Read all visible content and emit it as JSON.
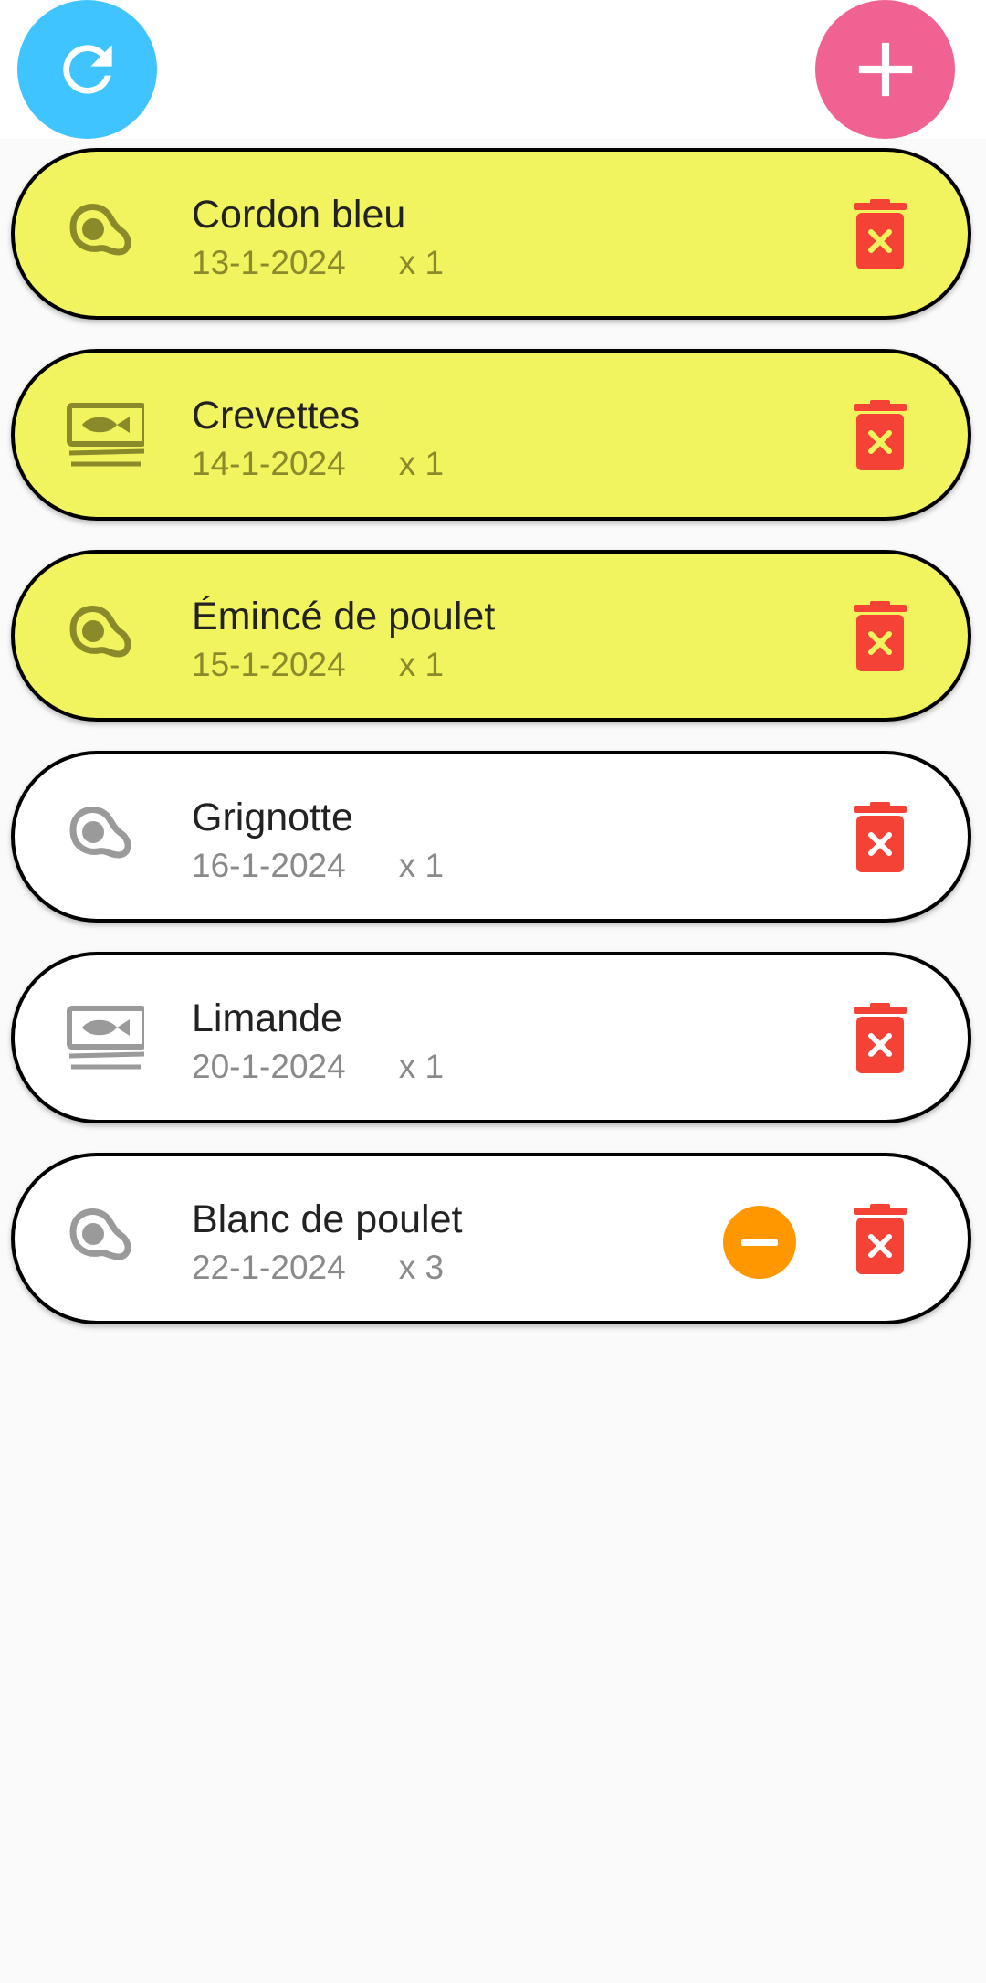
{
  "toolbar": {
    "refresh_icon": "refresh-icon",
    "add_icon": "plus-icon",
    "refresh_color": "#40c4ff",
    "add_color": "#f06292"
  },
  "colors": {
    "highlight_background": "#f1f45f",
    "plain_background": "#ffffff",
    "delete_color": "#f44336",
    "minus_color": "#ff9800"
  },
  "items": [
    {
      "name": "Cordon bleu",
      "date": "13-1-2024",
      "qty": "x 1",
      "icon": "meat-icon",
      "highlight": true,
      "minus": false
    },
    {
      "name": "Crevettes",
      "date": "14-1-2024",
      "qty": "x 1",
      "icon": "fish-icon",
      "highlight": true,
      "minus": false
    },
    {
      "name": "Émincé de poulet",
      "date": "15-1-2024",
      "qty": "x 1",
      "icon": "meat-icon",
      "highlight": true,
      "minus": false
    },
    {
      "name": "Grignotte",
      "date": "16-1-2024",
      "qty": "x 1",
      "icon": "meat-icon",
      "highlight": false,
      "minus": false
    },
    {
      "name": "Limande",
      "date": "20-1-2024",
      "qty": "x 1",
      "icon": "fish-icon",
      "highlight": false,
      "minus": false
    },
    {
      "name": "Blanc de poulet",
      "date": "22-1-2024",
      "qty": "x 3",
      "icon": "meat-icon",
      "highlight": false,
      "minus": true
    }
  ]
}
